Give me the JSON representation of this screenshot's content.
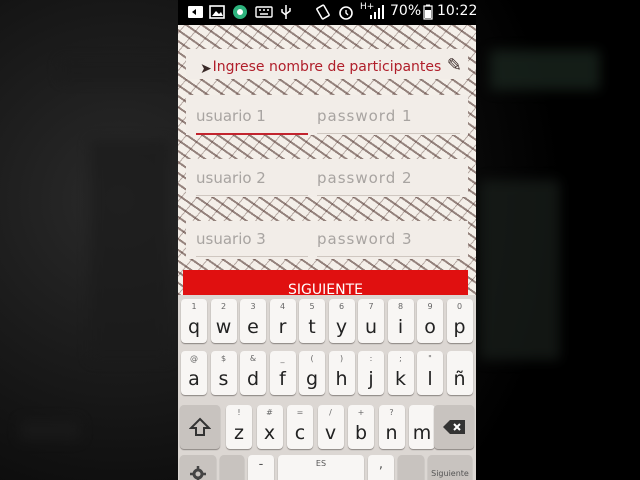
{
  "status_bar": {
    "battery": "70%",
    "time": "10:22",
    "network": "H+",
    "icons": [
      "notification-icon",
      "image-icon",
      "chrome-icon",
      "keyboard-icon",
      "usb-icon",
      "rotate-icon",
      "alarm-icon",
      "signal-icon",
      "battery-icon"
    ]
  },
  "app": {
    "title": "Ingrese nombre de participantes",
    "fields": [
      {
        "user_placeholder": "usuario 1",
        "pass_placeholder": "password  1"
      },
      {
        "user_placeholder": "usuario 2",
        "pass_placeholder": "password  2"
      },
      {
        "user_placeholder": "usuario 3",
        "pass_placeholder": "password  3"
      }
    ],
    "next_button": "SIGUIENTE",
    "accent_color": "#c2242e",
    "button_color": "#e01010"
  },
  "keyboard": {
    "row1": [
      {
        "hint": "1",
        "key": "q"
      },
      {
        "hint": "2",
        "key": "w"
      },
      {
        "hint": "3",
        "key": "e"
      },
      {
        "hint": "4",
        "key": "r"
      },
      {
        "hint": "5",
        "key": "t"
      },
      {
        "hint": "6",
        "key": "y"
      },
      {
        "hint": "7",
        "key": "u"
      },
      {
        "hint": "8",
        "key": "i"
      },
      {
        "hint": "9",
        "key": "o"
      },
      {
        "hint": "0",
        "key": "p"
      }
    ],
    "row2": [
      {
        "hint": "@",
        "key": "a"
      },
      {
        "hint": "$",
        "key": "s"
      },
      {
        "hint": "&",
        "key": "d"
      },
      {
        "hint": "_",
        "key": "f"
      },
      {
        "hint": "(",
        "key": "g"
      },
      {
        "hint": ")",
        "key": "h"
      },
      {
        "hint": ":",
        "key": "j"
      },
      {
        "hint": ";",
        "key": "k"
      },
      {
        "hint": "\"",
        "key": "l"
      },
      {
        "hint": "",
        "key": "ñ"
      }
    ],
    "row3": [
      {
        "hint": "!",
        "key": "z"
      },
      {
        "hint": "#",
        "key": "x"
      },
      {
        "hint": "=",
        "key": "c"
      },
      {
        "hint": "/",
        "key": "v"
      },
      {
        "hint": "+",
        "key": "b"
      },
      {
        "hint": "?",
        "key": "n"
      },
      {
        "hint": "",
        "key": "m"
      }
    ],
    "space_label": "ES",
    "dash_key": "-",
    "comma_key": ",",
    "action_label": "Siguiente"
  }
}
